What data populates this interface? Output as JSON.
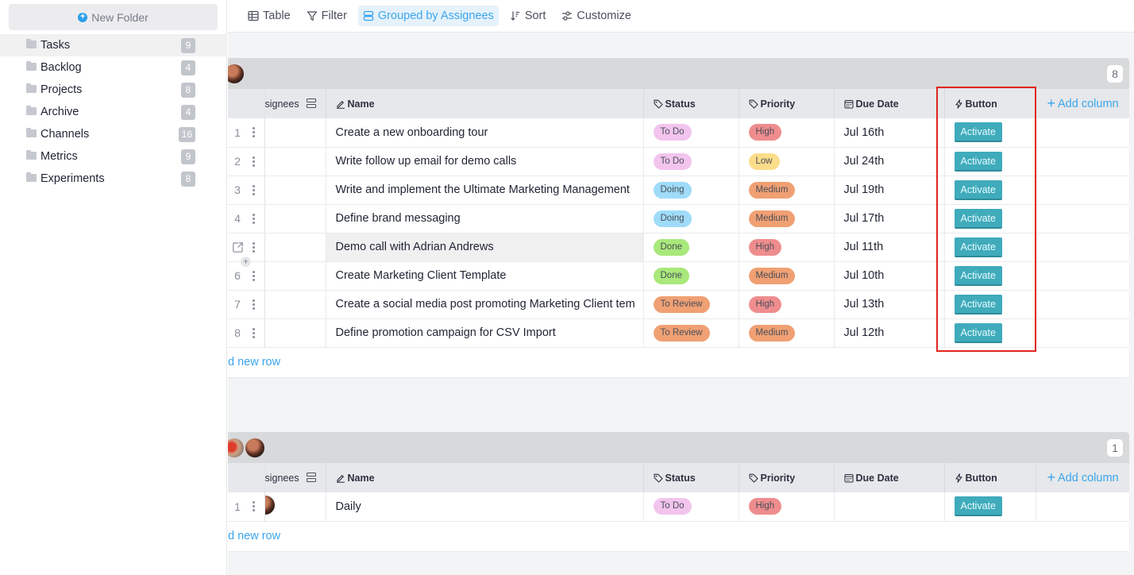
{
  "sidebar": {
    "new_folder_label": "New Folder",
    "folders": [
      {
        "label": "Tasks",
        "count": "9",
        "active": true
      },
      {
        "label": "Backlog",
        "count": "4"
      },
      {
        "label": "Projects",
        "count": "8"
      },
      {
        "label": "Archive",
        "count": "4"
      },
      {
        "label": "Channels",
        "count": "16"
      },
      {
        "label": "Metrics",
        "count": "9"
      },
      {
        "label": "Experiments",
        "count": "8"
      }
    ]
  },
  "toolbar": {
    "table": "Table",
    "filter": "Filter",
    "grouped": "Grouped by Assignees",
    "sort": "Sort",
    "customize": "Customize"
  },
  "columns": {
    "assignees": "signees",
    "name": "Name",
    "status": "Status",
    "priority": "Priority",
    "due_date": "Due Date",
    "button": "Button",
    "add_column": "Add column"
  },
  "colors": {
    "accent": "#3aa5ec",
    "button": "#3fabbb",
    "highlight": "#e0261e",
    "status": {
      "To Do": "#f2c4ee",
      "Doing": "#9fdcf9",
      "Done": "#a9e87a",
      "To Review": "#f0a073"
    },
    "priority": {
      "High": "#ef8d8e",
      "Low": "#fbdd8a",
      "Medium": "#f0a073"
    }
  },
  "groups": [
    {
      "count": "8",
      "add_row_label": "d new row",
      "rows": [
        {
          "num": "1",
          "name": "Create a new onboarding tour",
          "status": "To Do",
          "priority": "High",
          "due": "Jul 16th",
          "button": "Activate"
        },
        {
          "num": "2",
          "name": "Write follow up email for demo calls",
          "status": "To Do",
          "priority": "Low",
          "due": "Jul 24th",
          "button": "Activate"
        },
        {
          "num": "3",
          "name": "Write and implement the Ultimate Marketing Management",
          "status": "Doing",
          "priority": "Medium",
          "due": "Jul 19th",
          "button": "Activate"
        },
        {
          "num": "4",
          "name": "Define brand messaging",
          "status": "Doing",
          "priority": "Medium",
          "due": "Jul 17th",
          "button": "Activate"
        },
        {
          "num": "",
          "name": "Demo call with Adrian Andrews",
          "status": "Done",
          "priority": "High",
          "due": "Jul 11th",
          "button": "Activate",
          "hover": true
        },
        {
          "num": "6",
          "name": "Create Marketing Client Template",
          "status": "Done",
          "priority": "Medium",
          "due": "Jul 10th",
          "button": "Activate"
        },
        {
          "num": "7",
          "name": "Create a social media post promoting Marketing Client tem",
          "status": "To Review",
          "priority": "High",
          "due": "Jul 13th",
          "button": "Activate"
        },
        {
          "num": "8",
          "name": "Define promotion campaign for CSV Import",
          "status": "To Review",
          "priority": "Medium",
          "due": "Jul 12th",
          "button": "Activate"
        }
      ]
    },
    {
      "count": "1",
      "add_row_label": "d new row",
      "rows": [
        {
          "num": "1",
          "name": "Daily",
          "status": "To Do",
          "priority": "High",
          "due": "",
          "button": "Activate",
          "avatar": true
        }
      ]
    }
  ]
}
